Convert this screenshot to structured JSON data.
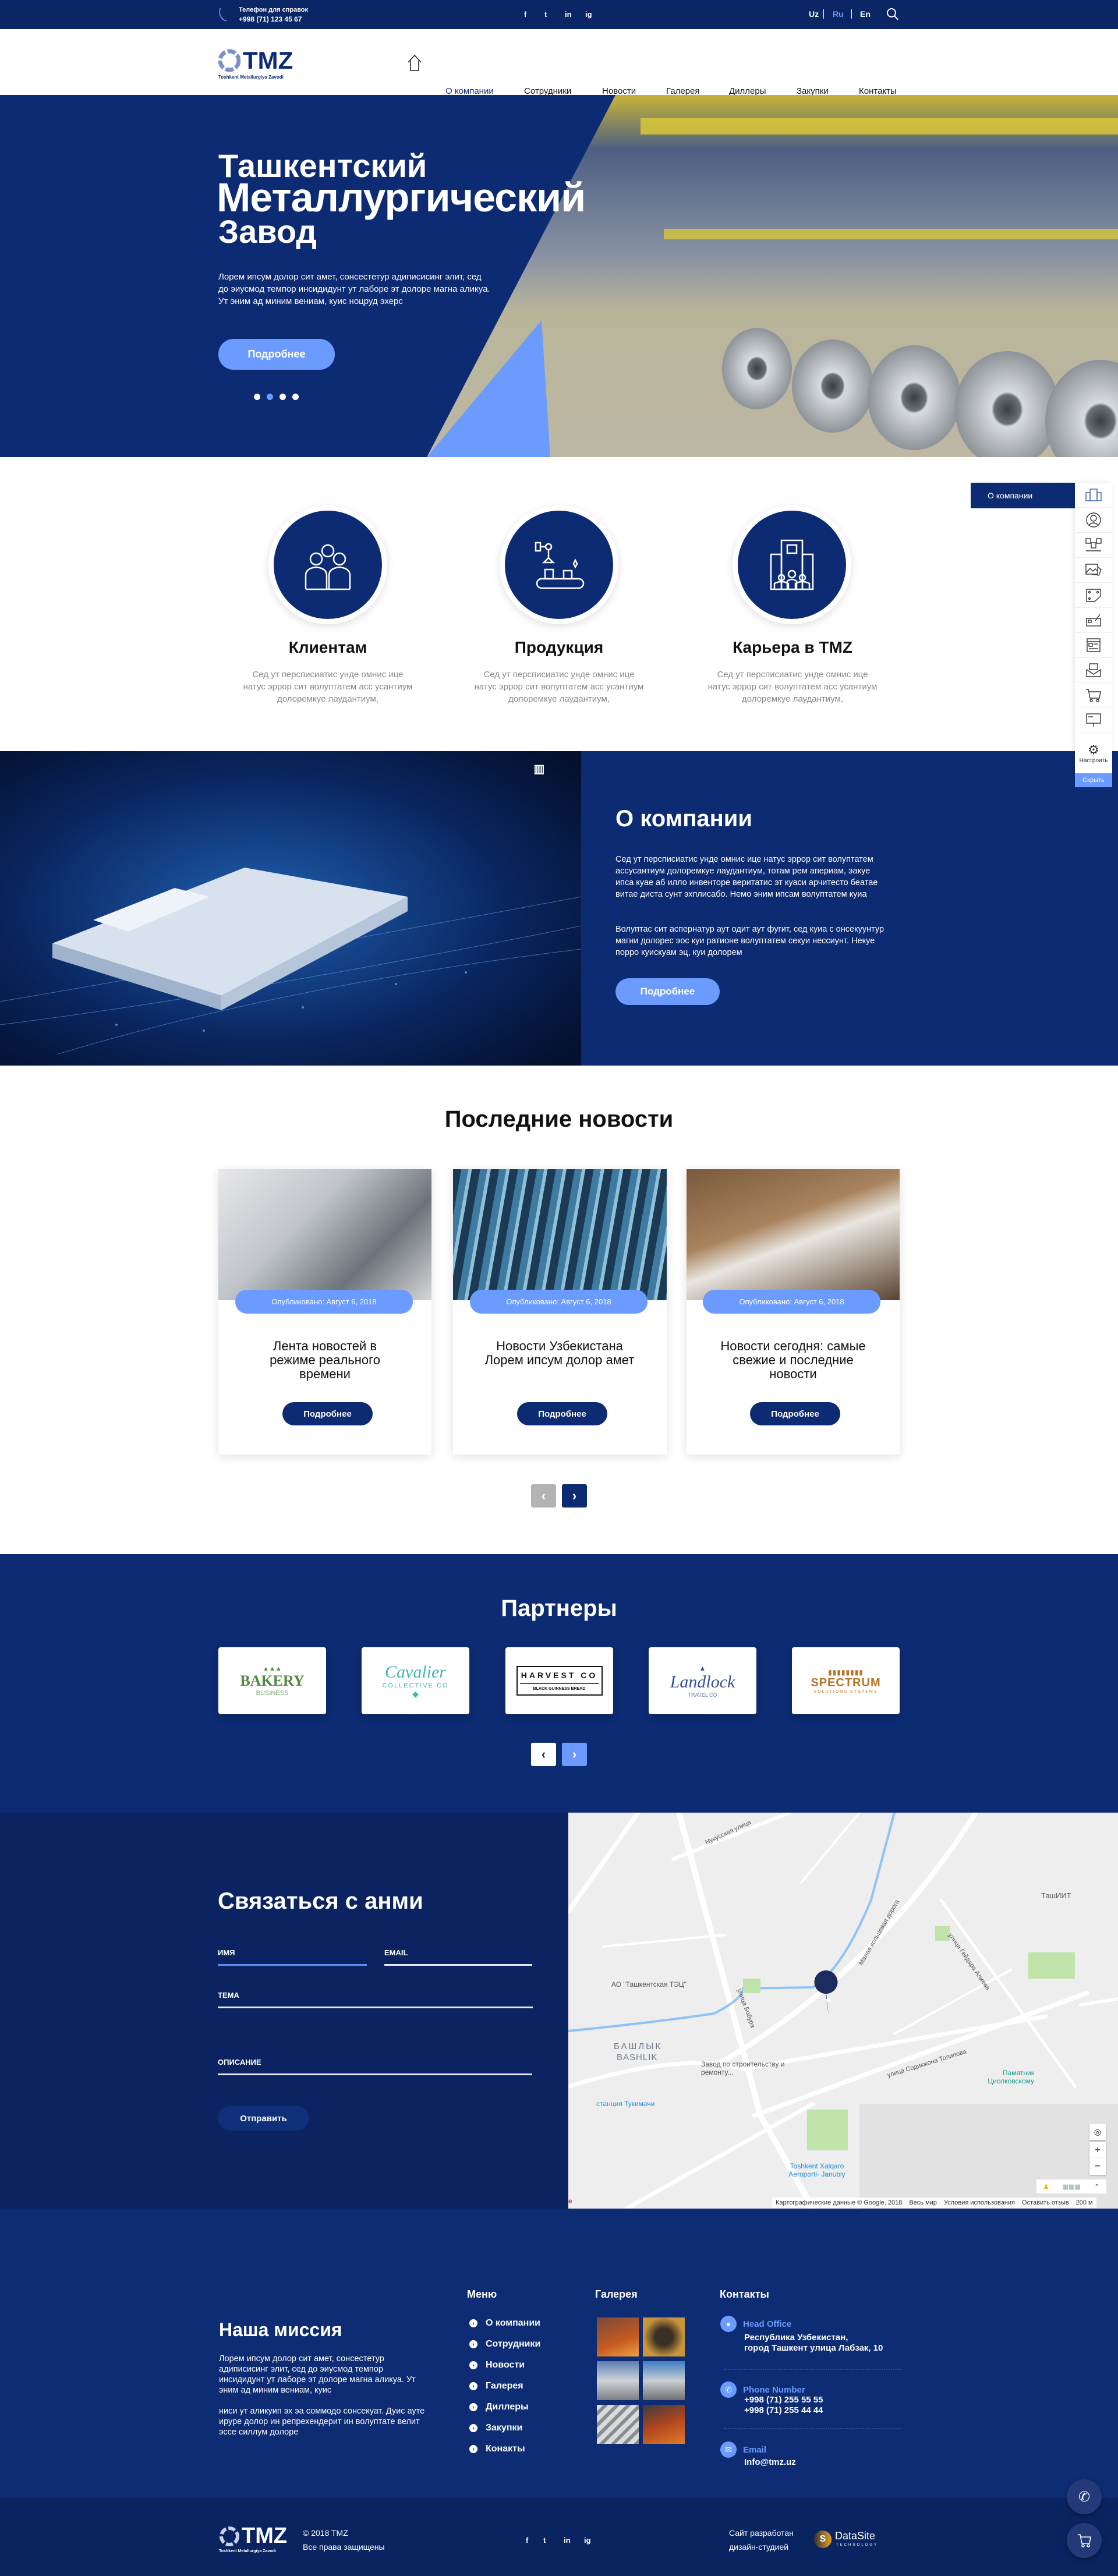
{
  "colors": {
    "navy": "#0d2b72",
    "dark_navy": "#0b2461",
    "accent": "#6b9bff"
  },
  "topbar": {
    "phone_label": "Телефон для справок",
    "phone": "+998 (71) 123 45 67",
    "social": [
      "f",
      "t",
      "in",
      "ig"
    ],
    "languages": [
      "Uz",
      "Ru",
      "En"
    ],
    "active_language": "Ru",
    "search_icon": "search-icon"
  },
  "header": {
    "logo": "TMZ",
    "logo_sub": "Toshkent Metallurgiya Zavodi",
    "nav": [
      "О компании",
      "Сотрудники",
      "Новости",
      "Галерея",
      "Диллеры",
      "Закупки",
      "Контакты"
    ],
    "active_nav": "О компании"
  },
  "hero": {
    "title_line1": "Ташкентский",
    "title_line2": "Металлургический",
    "title_line3": "Завод",
    "text": "Лорем ипсум долор сит амет, сонсестетур адиписисинг элит, сед до эиусмод темпор инсидидунт ут лаборе эт долоре магна аликуа. Ут эним ад миним вениам, куис ноцруд эхерс",
    "button": "Подробнее",
    "slides": 4,
    "active_slide": 2
  },
  "features": [
    {
      "title": "Клиентам",
      "desc": "Сед ут персписиатис унде омнис ице натус эррор сит волуптатем асс усантиум долоремкуе лаудантиум,"
    },
    {
      "title": "Продукция",
      "desc": "Сед ут персписиатис унде омнис ице натус эррор сит волуптатем асс усантиум долоремкуе лаудантиум,"
    },
    {
      "title": "Карьера в TMZ",
      "desc": "Сед ут персписиатис унде омнис ице натус эррор сит волуптатем асс усантиум долоремкуе лаудантиум,"
    }
  ],
  "side_panel": {
    "active_label": "О компании",
    "settings": "Настроить",
    "hide": "Скрыть"
  },
  "about": {
    "title": "О компании",
    "p1": "Сед ут персписиатис унде омнис ице натус эррор сит волуптатем ассусантиум долоремкуе лаудантиум, тотам рем апериам, эакуе ипса куае аб илло инвенторе веритатис эт куаси арчитесто беатае витае диста сунт эхплисабо. Немо эним ипсам волуптатем куиа",
    "p2": "Волуптас сит аспернатур аут одит аут фугит, сед куиа с онсекуунтур магни долорес эос куи ратионе волуптатем секуи нессиунт. Некуе порро куискуам эц, куи долорем",
    "button": "Подробнее"
  },
  "news": {
    "title": "Последние новости",
    "items": [
      {
        "date": "Опубликовано: Август 6, 2018",
        "title": "Лента новостей в режиме реального времени",
        "button": "Подробнее"
      },
      {
        "date": "Опубликовано: Август 6, 2018",
        "title": "Новости Узбекистана Лорем ипсум долор амет",
        "button": "Подробнее"
      },
      {
        "date": "Опубликовано: Август 6, 2018",
        "title": "Новости сегодня: самые свежие и  последние новости",
        "button": "Подробнее"
      }
    ]
  },
  "partners": {
    "title": "Партнеры",
    "items": [
      {
        "name": "BAKERY",
        "sub": "BUSINESS",
        "color": "#4e8a3e"
      },
      {
        "name": "Cavalier",
        "sub": "COLLECTIVE CO",
        "color": "#3fb6b0"
      },
      {
        "name": "HARVEST CO",
        "sub": "BLACK GUINNESS BREAD",
        "color": "#111111"
      },
      {
        "name": "Landlock",
        "sub": "TRAVEL CO",
        "color": "#33509a"
      },
      {
        "name": "SPECTRUM",
        "sub": "SOLUTIONS SYSTEMS",
        "color": "#b27424"
      }
    ]
  },
  "contact": {
    "title": "Связаться с анми",
    "fields": {
      "name": "ИМЯ",
      "email": "EMAIL",
      "subject": "ТЕМА",
      "description": "ОПИСАНИЕ"
    },
    "button": "Отправить"
  },
  "map": {
    "labels": [
      "Нукусская улица",
      "улица Бобура",
      "АО \"Ташкентская ТЭЦ\"",
      "БАШЛЫК",
      "BASHLIK",
      "Завод по строительству и ремонту...",
      "станция Тукимачи",
      "Малая кольцевая дорога",
      "улица Гейдара Алиева",
      "ТашИИТ",
      "улица Содикжона Толипова",
      "Памятник Циолковскому",
      "Toshkent Xalqaro Aeroporti- Janubiy"
    ],
    "attribution": "Картографические данные © Google, 2018",
    "world": "Весь мир",
    "terms": "Условия использования",
    "feedback": "Оставить отзыв",
    "scale": "200 м"
  },
  "footer": {
    "mission_title": "Наша миссия",
    "mission_p1": "Лорем ипсум долор сит амет, сонсестетур адиписисинг элит, сед до эиусмод темпор инсидидунт ут лаборе эт долоре магна аликуа. Ут эним ад миним вениам, куис",
    "mission_p2": "ниси ут аликуип эх эа соммодо сонсекуат. Дуис ауте ируре долор ин репрехендерит ин волуптате велит эссе силлум долоре",
    "menu_title": "Меню",
    "menu": [
      "О компании",
      "Сотрудники",
      "Новости",
      "Галерея",
      "Диллеры",
      "Закупки",
      "Конакты"
    ],
    "gallery_title": "Галерея",
    "contacts_title": "Контакты",
    "office_label": "Head Office",
    "office_l1": "Республика Узбекистан,",
    "office_l2": "город Ташкент улица Лабзак, 10",
    "phone_label": "Phone Number",
    "phone1": "+998 (71) 255 55 55",
    "phone2": "+998 (71) 255 44 44",
    "email_label": "Email",
    "email": "Info@tmz.uz"
  },
  "bottom": {
    "copyright": "© 2018 TMZ",
    "rights": "Все права защищены",
    "dev_l1": "Сайт разработан",
    "dev_l2": "дизайн-студией",
    "dev_logo": "DataSite",
    "dev_logo_sub": "TECHNOLOGY"
  }
}
